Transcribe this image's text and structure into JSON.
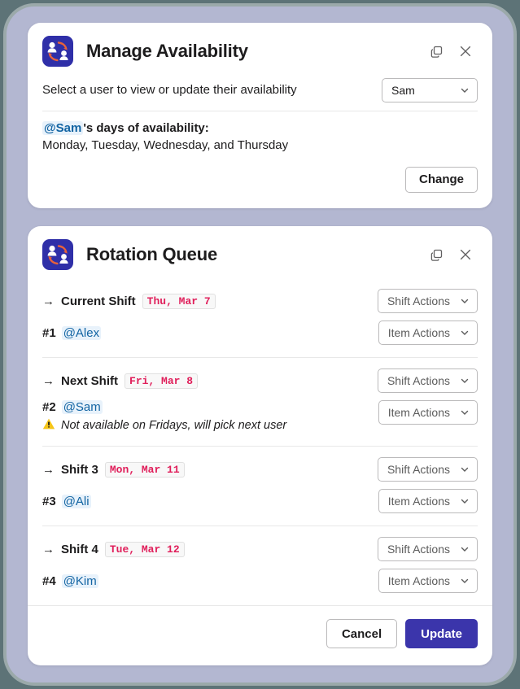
{
  "availability_card": {
    "icon": "rotation-app-icon",
    "title": "Manage Availability",
    "copy_icon": "copy-icon",
    "close_icon": "close-icon",
    "prompt": "Select a user to view or update their availability",
    "user_select": {
      "value": "Sam",
      "chevron": "chevron-down-icon"
    },
    "summary": {
      "mention": "@Sam",
      "suffix": "'s days of availability:",
      "days": "Monday, Tuesday, Wednesday, and Thursday"
    },
    "change_label": "Change"
  },
  "rotation_card": {
    "icon": "rotation-app-icon",
    "title": "Rotation Queue",
    "copy_icon": "copy-icon",
    "close_icon": "close-icon",
    "shift_action_label": "Shift Actions",
    "item_action_label": "Item Actions",
    "blocks": [
      {
        "arrow": "→",
        "shift_name": "Current Shift",
        "date": "Thu, Mar 7",
        "item_num": "#1",
        "item_user": "@Alex",
        "note": null
      },
      {
        "arrow": "→",
        "shift_name": "Next Shift",
        "date": "Fri, Mar 8",
        "item_num": "#2",
        "item_user": "@Sam",
        "note": "Not available on Fridays, will pick next user"
      },
      {
        "arrow": "→",
        "shift_name": "Shift 3",
        "date": "Mon, Mar 11",
        "item_num": "#3",
        "item_user": "@Ali",
        "note": null
      },
      {
        "arrow": "→",
        "shift_name": "Shift 4",
        "date": "Tue, Mar 12",
        "item_num": "#4",
        "item_user": "@Kim",
        "note": null
      }
    ],
    "footer": {
      "cancel_label": "Cancel",
      "update_label": "Update"
    }
  },
  "colors": {
    "page_background": "#5d7377",
    "frame": "#b3b7d1",
    "card": "#ffffff",
    "app_icon": "#2f2fa8",
    "app_icon_arrow": "#e8623a",
    "primary_button": "#3b35ab",
    "mention_text": "#1264a3",
    "mention_background": "#e8f2fb",
    "code_text": "#e01e5a",
    "warning": "#f5c518"
  }
}
